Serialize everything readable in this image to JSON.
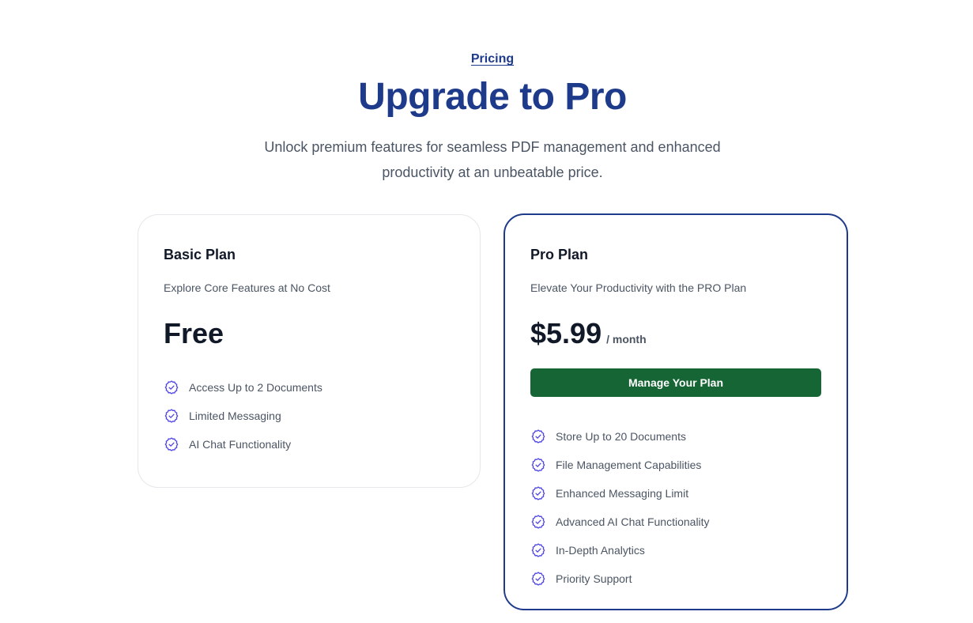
{
  "header": {
    "eyebrow": "Pricing",
    "title": "Upgrade to Pro",
    "subtitle": "Unlock premium features for seamless PDF management and enhanced productivity at an unbeatable price."
  },
  "colors": {
    "brand": "#1e3a8a",
    "button": "#166534",
    "check_icon": "#4f46e5"
  },
  "plans": [
    {
      "name": "Basic Plan",
      "description": "Explore Core Features at No Cost",
      "price": "Free",
      "features": [
        "Access Up to 2 Documents",
        "Limited Messaging",
        "AI Chat Functionality"
      ]
    },
    {
      "name": "Pro Plan",
      "description": "Elevate Your Productivity with the PRO Plan",
      "price": "$5.99",
      "period": "/ month",
      "button_label": "Manage Your Plan",
      "features": [
        "Store Up to 20 Documents",
        "File Management Capabilities",
        "Enhanced Messaging Limit",
        "Advanced AI Chat Functionality",
        "In-Depth Analytics",
        "Priority Support"
      ]
    }
  ],
  "icons": {
    "feature_check": "check-badge-icon"
  }
}
